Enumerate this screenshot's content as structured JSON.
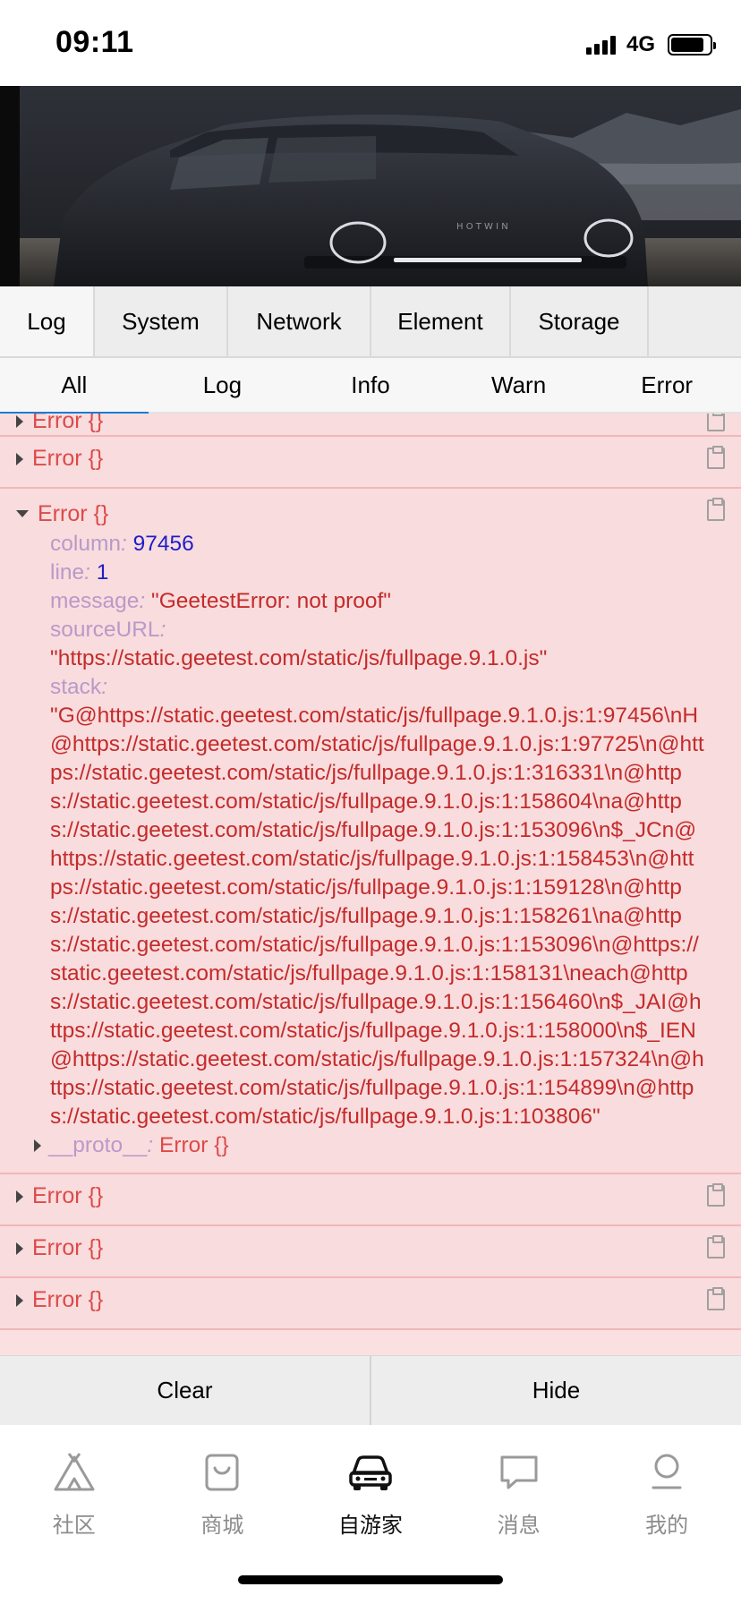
{
  "status_bar": {
    "time": "09:11",
    "network": "4G",
    "battery_level": 0.85
  },
  "main_tabs": [
    {
      "label": "Log",
      "active": true
    },
    {
      "label": "System",
      "active": false
    },
    {
      "label": "Network",
      "active": false
    },
    {
      "label": "Element",
      "active": false
    },
    {
      "label": "Storage",
      "active": false
    }
  ],
  "sub_tabs": [
    {
      "label": "All",
      "active": true
    },
    {
      "label": "Log",
      "active": false
    },
    {
      "label": "Info",
      "active": false
    },
    {
      "label": "Warn",
      "active": false
    },
    {
      "label": "Error",
      "active": false
    }
  ],
  "log": {
    "error_label": "Error {}",
    "expanded": {
      "props": [
        {
          "key": "column",
          "colon": ":",
          "value": "97456",
          "type": "number"
        },
        {
          "key": "line",
          "colon": ":",
          "value": "1",
          "type": "number"
        },
        {
          "key": "message",
          "colon": ":",
          "value": "\"GeetestError: not proof\"",
          "type": "string"
        },
        {
          "key": "sourceURL",
          "colon": ":",
          "value": "\"https://static.geetest.com/static/js/fullpage.9.1.0.js\"",
          "type": "string"
        },
        {
          "key": "stack",
          "colon": ":",
          "value": "\"G@https://static.geetest.com/static/js/fullpage.9.1.0.js:1:97456\\nH@https://static.geetest.com/static/js/fullpage.9.1.0.js:1:97725\\n@https://static.geetest.com/static/js/fullpage.9.1.0.js:1:316331\\n@https://static.geetest.com/static/js/fullpage.9.1.0.js:1:158604\\na@https://static.geetest.com/static/js/fullpage.9.1.0.js:1:153096\\n$_JCn@https://static.geetest.com/static/js/fullpage.9.1.0.js:1:158453\\n@https://static.geetest.com/static/js/fullpage.9.1.0.js:1:159128\\n@https://static.geetest.com/static/js/fullpage.9.1.0.js:1:158261\\na@https://static.geetest.com/static/js/fullpage.9.1.0.js:1:153096\\n@https://static.geetest.com/static/js/fullpage.9.1.0.js:1:158131\\neach@https://static.geetest.com/static/js/fullpage.9.1.0.js:1:156460\\n$_JAI@https://static.geetest.com/static/js/fullpage.9.1.0.js:1:158000\\n$_IEN@https://static.geetest.com/static/js/fullpage.9.1.0.js:1:157324\\n@https://static.geetest.com/static/js/fullpage.9.1.0.js:1:154899\\n@https://static.geetest.com/static/js/fullpage.9.1.0.js:1:103806\"",
          "type": "string"
        }
      ],
      "proto_key": "__proto__",
      "proto_colon": ":",
      "proto_value": "Error {}"
    }
  },
  "actions": {
    "clear": "Clear",
    "hide": "Hide"
  },
  "app_tabs": [
    {
      "label": "社区",
      "icon": "tent-icon",
      "active": false
    },
    {
      "label": "商城",
      "icon": "shopping-bag-icon",
      "active": false
    },
    {
      "label": "自游家",
      "icon": "car-icon",
      "active": true
    },
    {
      "label": "消息",
      "icon": "chat-bubble-icon",
      "active": false
    },
    {
      "label": "我的",
      "icon": "profile-icon",
      "active": false
    }
  ],
  "colors": {
    "error_text": "#dc4a4a",
    "error_bg": "#f9dcdd",
    "prop_key": "#b89ac9",
    "number": "#1e1ec9",
    "string": "#c42b2b",
    "active_tab_underline": "#1a7cd4"
  }
}
